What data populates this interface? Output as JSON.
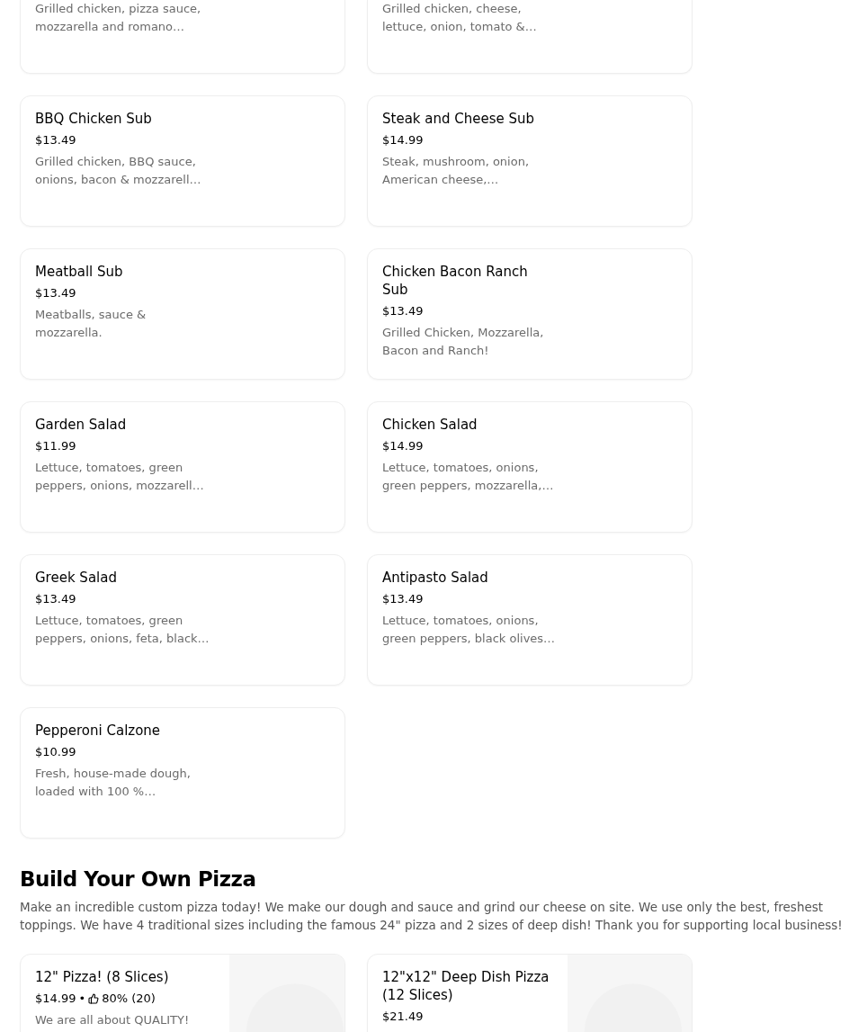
{
  "top_items": [
    {
      "description": "Grilled chicken, pizza sauce, mozzarella and romano…"
    },
    {
      "description": "Grilled chicken, cheese, lettuce, onion, tomato &…"
    }
  ],
  "items": [
    {
      "name": "BBQ Chicken Sub",
      "price": "$13.49",
      "description": "Grilled chicken, BBQ sauce, onions, bacon & mozzarell…"
    },
    {
      "name": "Steak and Cheese Sub",
      "price": "$14.99",
      "description": "Steak, mushroom, onion, American cheese,…"
    },
    {
      "name": "Meatball Sub",
      "price": "$13.49",
      "description": "Meatballs, sauce & mozzarella."
    },
    {
      "name": "Chicken Bacon Ranch Sub",
      "price": "$13.49",
      "description": "Grilled Chicken, Mozzarella, Bacon and Ranch!"
    },
    {
      "name": "Garden Salad",
      "price": "$11.99",
      "description": "Lettuce, tomatoes, green peppers, onions, mozzarell…"
    },
    {
      "name": "Chicken Salad",
      "price": "$14.99",
      "description": "Lettuce, tomatoes, onions, green peppers, mozzarella,…"
    },
    {
      "name": "Greek Salad",
      "price": "$13.49",
      "description": "Lettuce, tomatoes, green peppers, onions, feta, black…"
    },
    {
      "name": "Antipasto Salad",
      "price": "$13.49",
      "description": "Lettuce, tomatoes, onions, green peppers, black olives…"
    },
    {
      "name": "Pepperoni Calzone",
      "price": "$10.99",
      "description": "Fresh, house-made dough, loaded with 100 %…"
    }
  ],
  "section": {
    "title": "Build Your Own Pizza",
    "description": "Make an incredible custom pizza today! We make our dough and sauce and grind our cheese on site. We use only the best, freshest toppings. We have 4 traditional sizes including the famous 24\" pizza and 2 sizes of deep dish! Thank you for supporting local business!",
    "items": [
      {
        "name": "12\" Pizza! (8 Slices)",
        "price": "$14.99",
        "separator": "•",
        "rating": "80% (20)",
        "description": "We are all about QUALITY!",
        "kind": "picture"
      },
      {
        "name": "12\"x12\" Deep Dish Pizza (12 Slices)",
        "price": "$21.49",
        "kind": "picture"
      }
    ]
  }
}
